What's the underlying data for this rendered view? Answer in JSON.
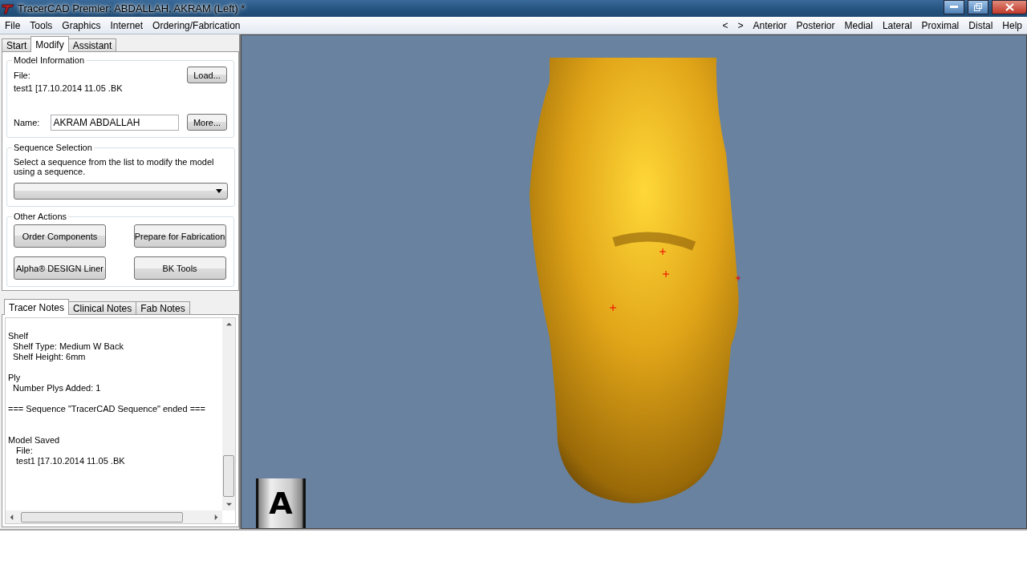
{
  "window": {
    "title": "TracerCAD Premier: ABDALLAH, AKRAM (Left) *"
  },
  "menu": {
    "left": [
      "File",
      "Tools",
      "Graphics",
      "Internet",
      "Ordering/Fabrication"
    ],
    "right": [
      "<",
      ">",
      "Anterior",
      "Posterior",
      "Medial",
      "Lateral",
      "Proximal",
      "Distal",
      "Help"
    ]
  },
  "tabs": [
    {
      "label": "Start",
      "selected": false
    },
    {
      "label": "Modify",
      "selected": true
    },
    {
      "label": "Assistant",
      "selected": false
    }
  ],
  "model_information": {
    "title": "Model Information",
    "file_label": "File:",
    "file_value": "test1 [17.10.2014 11.05 .BK",
    "load_button": "Load...",
    "name_label": "Name:",
    "name_value": "AKRAM ABDALLAH",
    "more_button": "More..."
  },
  "sequence_selection": {
    "title": "Sequence Selection",
    "description": "Select a sequence from the list to modify the model using a sequence."
  },
  "other_actions": {
    "title": "Other Actions",
    "buttons": [
      "Order Components",
      "Prepare for Fabrication",
      "Alpha® DESIGN Liner",
      "BK Tools"
    ]
  },
  "notes_tabs": [
    {
      "label": "Tracer Notes",
      "selected": true
    },
    {
      "label": "Clinical Notes",
      "selected": false
    },
    {
      "label": "Fab Notes",
      "selected": false
    }
  ],
  "notes": [
    {
      "kind": "heading",
      "text": "Shelf"
    },
    {
      "kind": "detail",
      "text": "Shelf Type: Medium W Back"
    },
    {
      "kind": "detail",
      "text": "Shelf Height: 6mm"
    },
    {
      "kind": "gap"
    },
    {
      "kind": "heading",
      "text": "Ply"
    },
    {
      "kind": "detail",
      "text": "Number Plys Added: 1"
    },
    {
      "kind": "gap"
    },
    {
      "kind": "heading",
      "text": "=== Sequence \"TracerCAD Sequence\" ended ==="
    },
    {
      "kind": "gap"
    },
    {
      "kind": "gap"
    },
    {
      "kind": "heading",
      "text": "Model Saved"
    },
    {
      "kind": "subdetail",
      "text": "File:"
    },
    {
      "kind": "subdetail",
      "text": "test1 [17.10.2014 11.05 .BK"
    }
  ],
  "viewport": {
    "orientation_label": "A"
  }
}
